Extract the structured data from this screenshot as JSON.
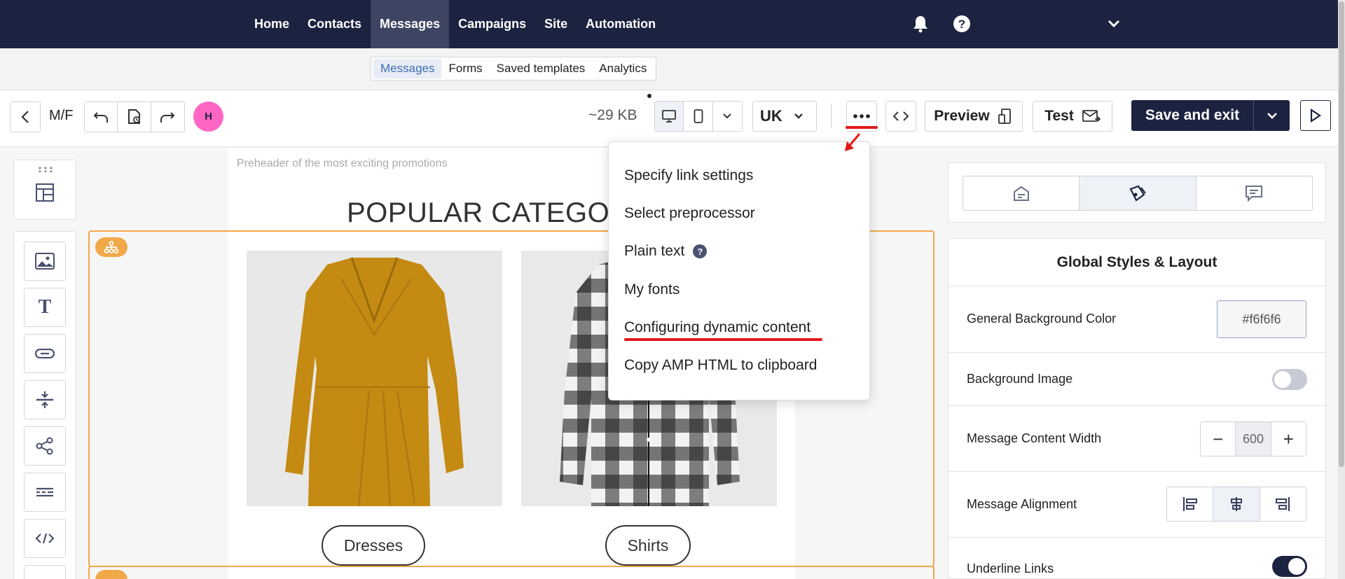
{
  "topnav": {
    "items": [
      {
        "label": "Home",
        "active": false
      },
      {
        "label": "Contacts",
        "active": false
      },
      {
        "label": "Messages",
        "active": true
      },
      {
        "label": "Campaigns",
        "active": false
      },
      {
        "label": "Site",
        "active": false
      },
      {
        "label": "Automation",
        "active": false
      }
    ],
    "icons": [
      "bell-icon",
      "help-icon",
      "chevron-down-icon"
    ]
  },
  "subnav": {
    "tabs": [
      {
        "label": "Messages",
        "active": true
      },
      {
        "label": "Forms",
        "active": false
      },
      {
        "label": "Saved templates",
        "active": false
      },
      {
        "label": "Analytics",
        "active": false
      }
    ]
  },
  "toolbar": {
    "message_name": "M/F",
    "avatar_initial": "H",
    "size": "~29 KB",
    "language": "UK",
    "preview_label": "Preview",
    "test_label": "Test",
    "save_label": "Save and exit",
    "device_selected": "desktop"
  },
  "dropdown": {
    "items": [
      {
        "label": "Specify link settings"
      },
      {
        "label": "Select preprocessor"
      },
      {
        "label": "Plain text",
        "help": "?"
      },
      {
        "label": "My fonts"
      },
      {
        "label": "Configuring dynamic content",
        "highlighted": true
      },
      {
        "label": "Copy AMP HTML to clipboard"
      }
    ]
  },
  "canvas": {
    "preheader": "Preheader of the most exciting promotions",
    "category_title": "POPULAR CATEGO",
    "products": [
      {
        "name": "dress",
        "button": "Dresses"
      },
      {
        "name": "shirt",
        "button": "Shirts"
      }
    ]
  },
  "right_panel": {
    "title": "Global Styles & Layout",
    "rows": {
      "bg_color": {
        "label": "General Background Color",
        "value": "#f6f6f6"
      },
      "bg_image": {
        "label": "Background Image",
        "on": false
      },
      "content_width": {
        "label": "Message Content Width",
        "value": "600"
      },
      "alignment": {
        "label": "Message Alignment",
        "selected": "center"
      },
      "underline": {
        "label": "Underline Links",
        "on": true
      }
    }
  },
  "colors": {
    "nav_bg": "#1c2340",
    "accent_orange": "#f0a848",
    "avatar": "#ff66c4",
    "annotation_red": "#e1191b"
  }
}
